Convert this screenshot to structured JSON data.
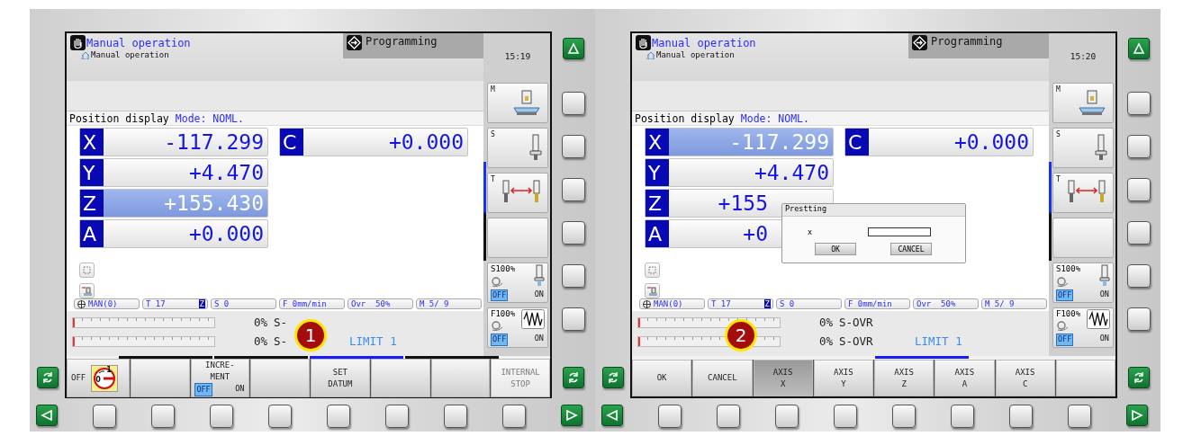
{
  "panels": [
    {
      "clock": "15:19",
      "header": {
        "title": "Manual operation",
        "subtitle": "Manual operation",
        "tab": "Programming"
      },
      "position_display": {
        "label": "Position display",
        "mode": "Mode: NOML."
      },
      "position_columns": [
        {
          "axes": [
            {
              "letter": "X",
              "value": "-117.299",
              "selected": false,
              "partly_hidden": false
            },
            {
              "letter": "Y",
              "value": "+4.470",
              "selected": false,
              "partly_hidden": false
            },
            {
              "letter": "Z",
              "value": "+155.430",
              "selected": true,
              "partly_hidden": false
            },
            {
              "letter": "A",
              "value": "+0.000",
              "selected": false,
              "partly_hidden": false
            }
          ]
        },
        {
          "axes": [
            {
              "letter": "C",
              "value": "+0.000",
              "selected": false,
              "partly_hidden": false
            }
          ]
        }
      ],
      "status_fields": [
        {
          "kind": "mode",
          "text": "MAN(0)"
        },
        {
          "kind": "tool",
          "text": "T 17",
          "tag": "Z"
        },
        {
          "kind": "plain",
          "text": "S 0"
        },
        {
          "kind": "plain",
          "text": "F 0mm/min"
        },
        {
          "kind": "plain",
          "text": "Ovr  50%"
        },
        {
          "kind": "plain",
          "text": "M 5/ 9"
        }
      ],
      "overrides": [
        {
          "level": 0,
          "percent": "0%",
          "label": "S-"
        },
        {
          "level": 0,
          "percent": "0%",
          "label": "S-",
          "note": "LIMIT 1"
        }
      ],
      "badge": {
        "text": "1"
      },
      "page_markers": [
        {
          "shown": true,
          "selected": false
        },
        {
          "shown": true,
          "selected": false
        },
        {
          "shown": true,
          "selected": true
        },
        {
          "shown": true,
          "selected": false
        }
      ],
      "side_keys": [
        {
          "kind": "machine",
          "letter": "M"
        },
        {
          "kind": "spindle",
          "letter": "S"
        },
        {
          "kind": "toolchange",
          "letter": "T"
        },
        {
          "kind": "blank"
        },
        {
          "kind": "spindle-override",
          "label": "S100%",
          "off": "OFF",
          "on": "ON",
          "state_on": false
        },
        {
          "kind": "feed-override",
          "label": "F100%",
          "off": "OFF",
          "on": "ON",
          "state_on": false
        }
      ],
      "softkeys": [
        {
          "kind": "switch",
          "label": "OFF",
          "dial_marks": [
            "1",
            "0"
          ],
          "selected": false,
          "disabled": false
        },
        {
          "kind": "key",
          "selected": false,
          "disabled": false
        },
        {
          "kind": "toggle",
          "label": "INCRE-\nMENT",
          "off": "OFF",
          "on": "ON",
          "state_on": false,
          "selected": false,
          "disabled": false
        },
        {
          "kind": "key",
          "selected": false,
          "disabled": false
        },
        {
          "kind": "key",
          "label": "SET\nDATUM",
          "selected": false,
          "disabled": false
        },
        {
          "kind": "key",
          "selected": false,
          "disabled": false
        },
        {
          "kind": "key",
          "selected": false,
          "disabled": false
        },
        {
          "kind": "key",
          "label": "INTERNAL\nSTOP",
          "selected": false,
          "disabled": true
        }
      ]
    },
    {
      "clock": "15:20",
      "header": {
        "title": "Manual operation",
        "subtitle": "Manual operation",
        "tab": "Programming"
      },
      "position_display": {
        "label": "Position display",
        "mode": "Mode: NOML."
      },
      "position_columns": [
        {
          "axes": [
            {
              "letter": "X",
              "value": "-117.299",
              "selected": true,
              "partly_hidden": false
            },
            {
              "letter": "Y",
              "value": "+4.470",
              "selected": false,
              "partly_hidden": false
            },
            {
              "letter": "Z",
              "value": "+155",
              "selected": false,
              "partly_hidden": true
            },
            {
              "letter": "A",
              "value": "+0",
              "selected": false,
              "partly_hidden": true
            }
          ]
        },
        {
          "axes": [
            {
              "letter": "C",
              "value": "+0.000",
              "selected": false,
              "partly_hidden": false
            }
          ]
        }
      ],
      "status_fields": [
        {
          "kind": "mode",
          "text": "MAN(0)"
        },
        {
          "kind": "tool",
          "text": "T 17",
          "tag": "Z"
        },
        {
          "kind": "plain",
          "text": "S 0"
        },
        {
          "kind": "plain",
          "text": "F 0mm/min"
        },
        {
          "kind": "plain",
          "text": "Ovr  50%"
        },
        {
          "kind": "plain",
          "text": "M 5/ 9"
        }
      ],
      "overrides": [
        {
          "level": 0,
          "percent": "0%",
          "label": "S-OVR"
        },
        {
          "level": 0,
          "percent": "0%",
          "label": "S-OVR",
          "note": "LIMIT 1"
        }
      ],
      "badge": {
        "text": "2"
      },
      "dialog": {
        "title": "Prestting",
        "field_label": "x",
        "buttons": [
          "OK",
          "CANCEL"
        ]
      },
      "page_markers": [
        {
          "shown": false,
          "selected": false
        },
        {
          "shown": false,
          "selected": false
        },
        {
          "shown": true,
          "selected": true
        },
        {
          "shown": false,
          "selected": false
        }
      ],
      "side_keys": [
        {
          "kind": "machine",
          "letter": "M"
        },
        {
          "kind": "spindle",
          "letter": "S"
        },
        {
          "kind": "toolchange",
          "letter": "T"
        },
        {
          "kind": "blank"
        },
        {
          "kind": "spindle-override",
          "label": "S100%",
          "off": "OFF",
          "on": "ON",
          "state_on": false
        },
        {
          "kind": "feed-override",
          "label": "F100%",
          "off": "OFF",
          "on": "ON",
          "state_on": false
        }
      ],
      "softkeys": [
        {
          "kind": "key",
          "label": "OK",
          "selected": false,
          "disabled": false
        },
        {
          "kind": "key",
          "label": "CANCEL",
          "selected": false,
          "disabled": false
        },
        {
          "kind": "key",
          "label": "AXIS\nX",
          "selected": true,
          "disabled": false
        },
        {
          "kind": "key",
          "label": "AXIS\nY",
          "selected": false,
          "disabled": false
        },
        {
          "kind": "key",
          "label": "AXIS\nZ",
          "selected": false,
          "disabled": false
        },
        {
          "kind": "key",
          "label": "AXIS\nA",
          "selected": false,
          "disabled": false
        },
        {
          "kind": "key",
          "label": "AXIS\nC",
          "selected": false,
          "disabled": false
        },
        {
          "kind": "key",
          "selected": false,
          "disabled": false
        }
      ]
    }
  ]
}
